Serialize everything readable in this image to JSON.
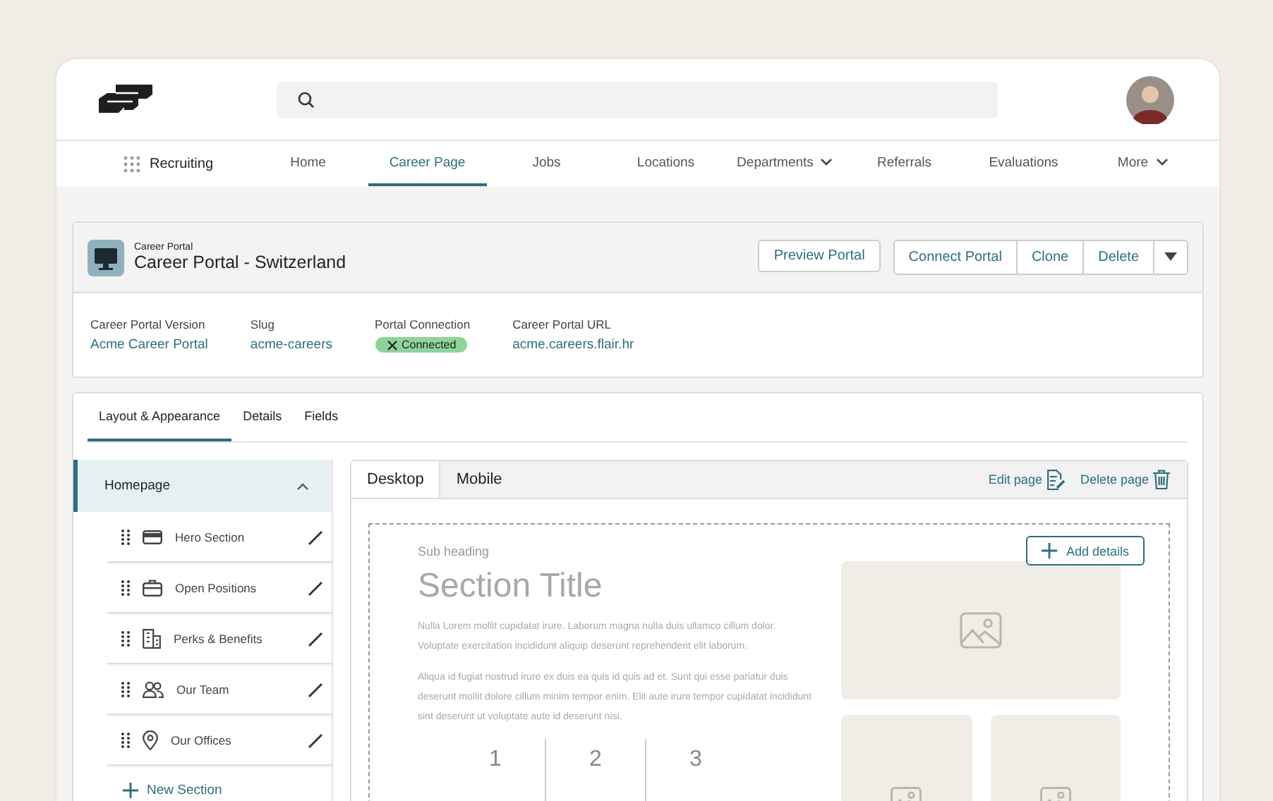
{
  "nav": {
    "app_name": "Recruiting",
    "items": [
      {
        "label": "Home",
        "selected": false,
        "dropdown": false
      },
      {
        "label": "Career Page",
        "selected": true,
        "dropdown": false
      },
      {
        "label": "Jobs",
        "selected": false,
        "dropdown": false
      },
      {
        "label": "Locations",
        "selected": false,
        "dropdown": false
      },
      {
        "label": "Departments",
        "selected": false,
        "dropdown": true
      },
      {
        "label": "Referrals",
        "selected": false,
        "dropdown": false
      },
      {
        "label": "Evaluations",
        "selected": false,
        "dropdown": false
      },
      {
        "label": "More",
        "selected": false,
        "dropdown": true
      }
    ]
  },
  "record": {
    "type_label": "Career Portal",
    "title": "Career Portal - Switzerland",
    "primary_action": "Preview Portal",
    "action_group": [
      "Connect Portal",
      "Clone",
      "Delete"
    ],
    "fields": [
      {
        "label": "Career Portal Version",
        "value": "Acme Career Portal",
        "kind": "link"
      },
      {
        "label": "Slug",
        "value": "acme-careers",
        "kind": "link"
      },
      {
        "label": "Portal Connection",
        "value": "Connected",
        "kind": "badge"
      },
      {
        "label": "Career Portal URL",
        "value": "acme.careers.flair.hr",
        "kind": "link"
      }
    ]
  },
  "tabs": [
    {
      "label": "Layout & Appearance",
      "selected": true
    },
    {
      "label": "Details",
      "selected": false
    },
    {
      "label": "Fields",
      "selected": false
    }
  ],
  "sidebar": {
    "page": {
      "label": "Homepage",
      "expanded": true
    },
    "sections": [
      {
        "label": "Hero Section"
      },
      {
        "label": "Open Positions"
      },
      {
        "label": "Perks & Benefits"
      },
      {
        "label": "Our Team"
      },
      {
        "label": "Our Offices"
      }
    ],
    "add_label": "New Section"
  },
  "preview": {
    "tabs": [
      {
        "label": "Desktop",
        "selected": true
      },
      {
        "label": "Mobile",
        "selected": false
      }
    ],
    "actions": [
      {
        "label": "Edit page",
        "kind": "edit"
      },
      {
        "label": "Delete page",
        "kind": "delete"
      }
    ],
    "add_details": "Add details",
    "sub_heading": "Sub heading",
    "title": "Section Title",
    "paragraphs": [
      "Nulla Lorem mollit cupidatat irure. Laborum magna nulla duis ullamco cillum dolor. Voluptate exercitation incididunt aliquip deserunt reprehenderit elit laborum.",
      "Aliqua id fugiat nostrud irure ex duis ea quis id quis ad et. Sunt qui esse pariatur duis deserunt mollit dolore cillum minim tempor enim. Elit aute irure tempor cupidatat incididunt sint deserunt ut voluptate aute id deserunt nisi."
    ],
    "stats": [
      "1",
      "2",
      "3"
    ]
  }
}
